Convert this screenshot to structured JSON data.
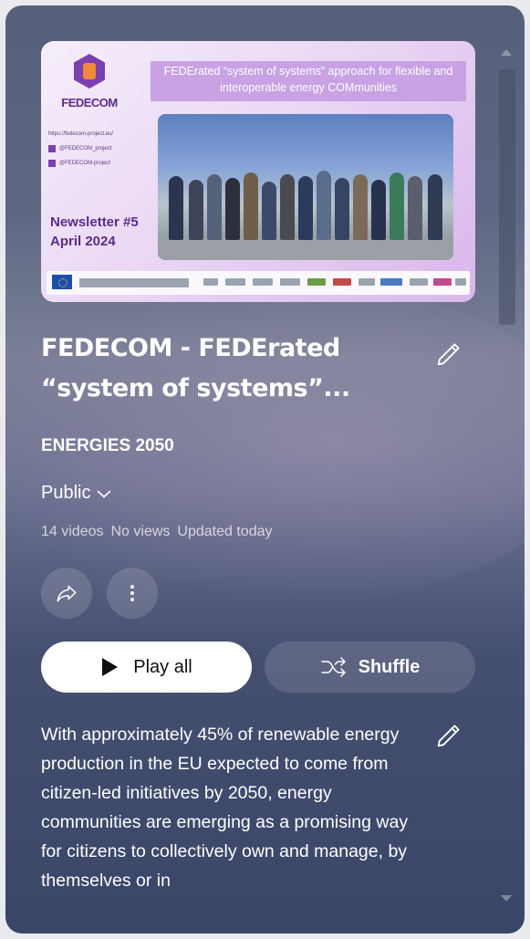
{
  "thumbnail": {
    "logo_text": "FEDECOM",
    "heading": "FEDErated “system of systems” approach for flexible and interoperable energy COMmunities",
    "links": [
      "https://fedecom-project.eu/",
      "@FEDECOM_project",
      "@FEDECOM-project"
    ],
    "newsletter_label": "Newsletter #5",
    "newsletter_date": "April 2024"
  },
  "playlist": {
    "title": "FEDECOM - FEDErated “system of systems”...",
    "channel": "ENERGIES 2050",
    "privacy": "Public",
    "video_count": "14 videos",
    "views": "No views",
    "updated": "Updated today",
    "description": "With approximately 45% of renewable energy production in the EU expected to come from citizen-led initiatives by 2050, energy communities are emerging as a promising way for citizens to collectively own and manage, by themselves or in"
  },
  "actions": {
    "play_all_label": "Play all",
    "shuffle_label": "Shuffle"
  },
  "icons": [
    "pencil-icon",
    "chevron-down-icon",
    "share-icon",
    "more-vert-icon",
    "play-icon",
    "shuffle-icon"
  ],
  "colors": {
    "accent_purple": "#7b3fb0",
    "button_white": "#ffffff"
  }
}
